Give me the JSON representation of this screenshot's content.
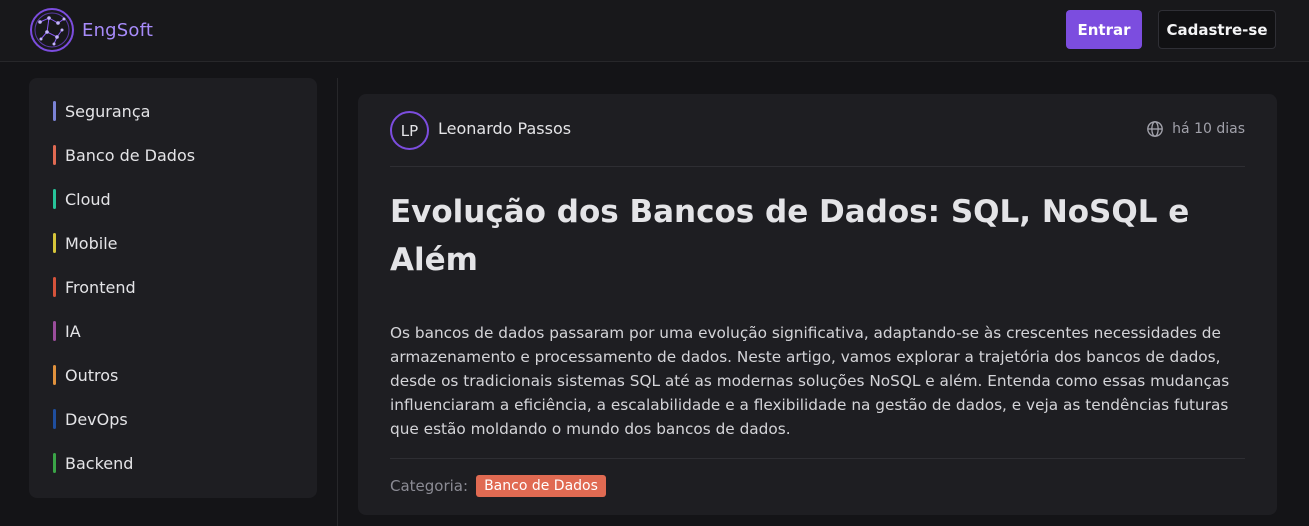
{
  "header": {
    "brand": "EngSoft",
    "login_label": "Entrar",
    "signup_label": "Cadastre-se"
  },
  "sidebar": {
    "items": [
      {
        "label": "Segurança",
        "color": "#7b83d6"
      },
      {
        "label": "Banco de Dados",
        "color": "#e06a52"
      },
      {
        "label": "Cloud",
        "color": "#27c49a"
      },
      {
        "label": "Mobile",
        "color": "#d6c53a"
      },
      {
        "label": "Frontend",
        "color": "#d5533b"
      },
      {
        "label": "IA",
        "color": "#9b4d9c"
      },
      {
        "label": "Outros",
        "color": "#e0913d"
      },
      {
        "label": "DevOps",
        "color": "#1f4e9e"
      },
      {
        "label": "Backend",
        "color": "#3aa447"
      }
    ]
  },
  "post": {
    "avatar_initials": "LP",
    "author": "Leonardo Passos",
    "time": "há 10 dias",
    "time_icon": "globe-icon",
    "title": "Evolução dos Bancos de Dados: SQL, NoSQL e Além",
    "body": "Os bancos de dados passaram por uma evolução significativa, adaptando-se às crescentes necessidades de armazenamento e processamento de dados. Neste artigo, vamos explorar a trajetória dos bancos de dados, desde os tradicionais sistemas SQL até as modernas soluções NoSQL e além. Entenda como essas mudanças influenciaram a eficiência, a escalabilidade e a flexibilidade na gestão de dados, e veja as tendências futuras que estão moldando o mundo dos bancos de dados.",
    "category_label": "Categoria:",
    "category": "Banco de Dados",
    "category_color": "#e06a52"
  },
  "colors": {
    "accent": "#7c4ddf",
    "background": "#141417",
    "card": "#1e1e22"
  }
}
